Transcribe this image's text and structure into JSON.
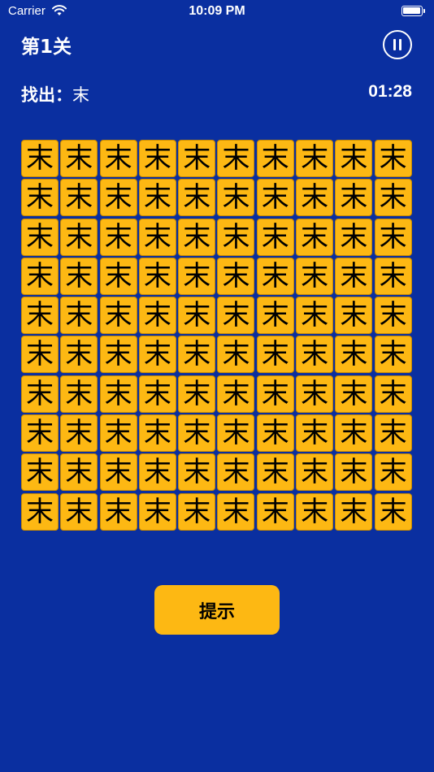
{
  "status_bar": {
    "carrier": "Carrier",
    "time": "10:09 PM"
  },
  "header": {
    "level": "第1关"
  },
  "target": {
    "prompt": "找出：",
    "char": "末"
  },
  "timer": "01:28",
  "grid": {
    "rows": 10,
    "cols": 10,
    "cells": [
      "末",
      "末",
      "末",
      "末",
      "末",
      "末",
      "末",
      "末",
      "末",
      "末",
      "末",
      "末",
      "末",
      "末",
      "末",
      "末",
      "末",
      "末",
      "末",
      "末",
      "末",
      "末",
      "末",
      "末",
      "末",
      "末",
      "末",
      "末",
      "末",
      "末",
      "末",
      "末",
      "末",
      "末",
      "末",
      "末",
      "末",
      "末",
      "末",
      "末",
      "末",
      "末",
      "末",
      "末",
      "末",
      "末",
      "末",
      "末",
      "末",
      "末",
      "末",
      "末",
      "末",
      "末",
      "末",
      "末",
      "末",
      "末",
      "末",
      "末",
      "末",
      "末",
      "末",
      "末",
      "末",
      "末",
      "末",
      "末",
      "末",
      "末",
      "末",
      "末",
      "末",
      "末",
      "末",
      "末",
      "末",
      "末",
      "末",
      "末",
      "末",
      "末",
      "末",
      "末",
      "末",
      "末",
      "末",
      "末",
      "末",
      "末",
      "末",
      "末",
      "末",
      "末",
      "末",
      "末",
      "末",
      "末",
      "末",
      "末"
    ]
  },
  "hint_button": {
    "label": "提示"
  },
  "colors": {
    "background": "#0a2fa0",
    "tile": "#fdb813",
    "text": "#ffffff"
  },
  "icons": {
    "pause": "pause-circle-icon",
    "wifi": "wifi-icon",
    "battery": "battery-icon"
  }
}
